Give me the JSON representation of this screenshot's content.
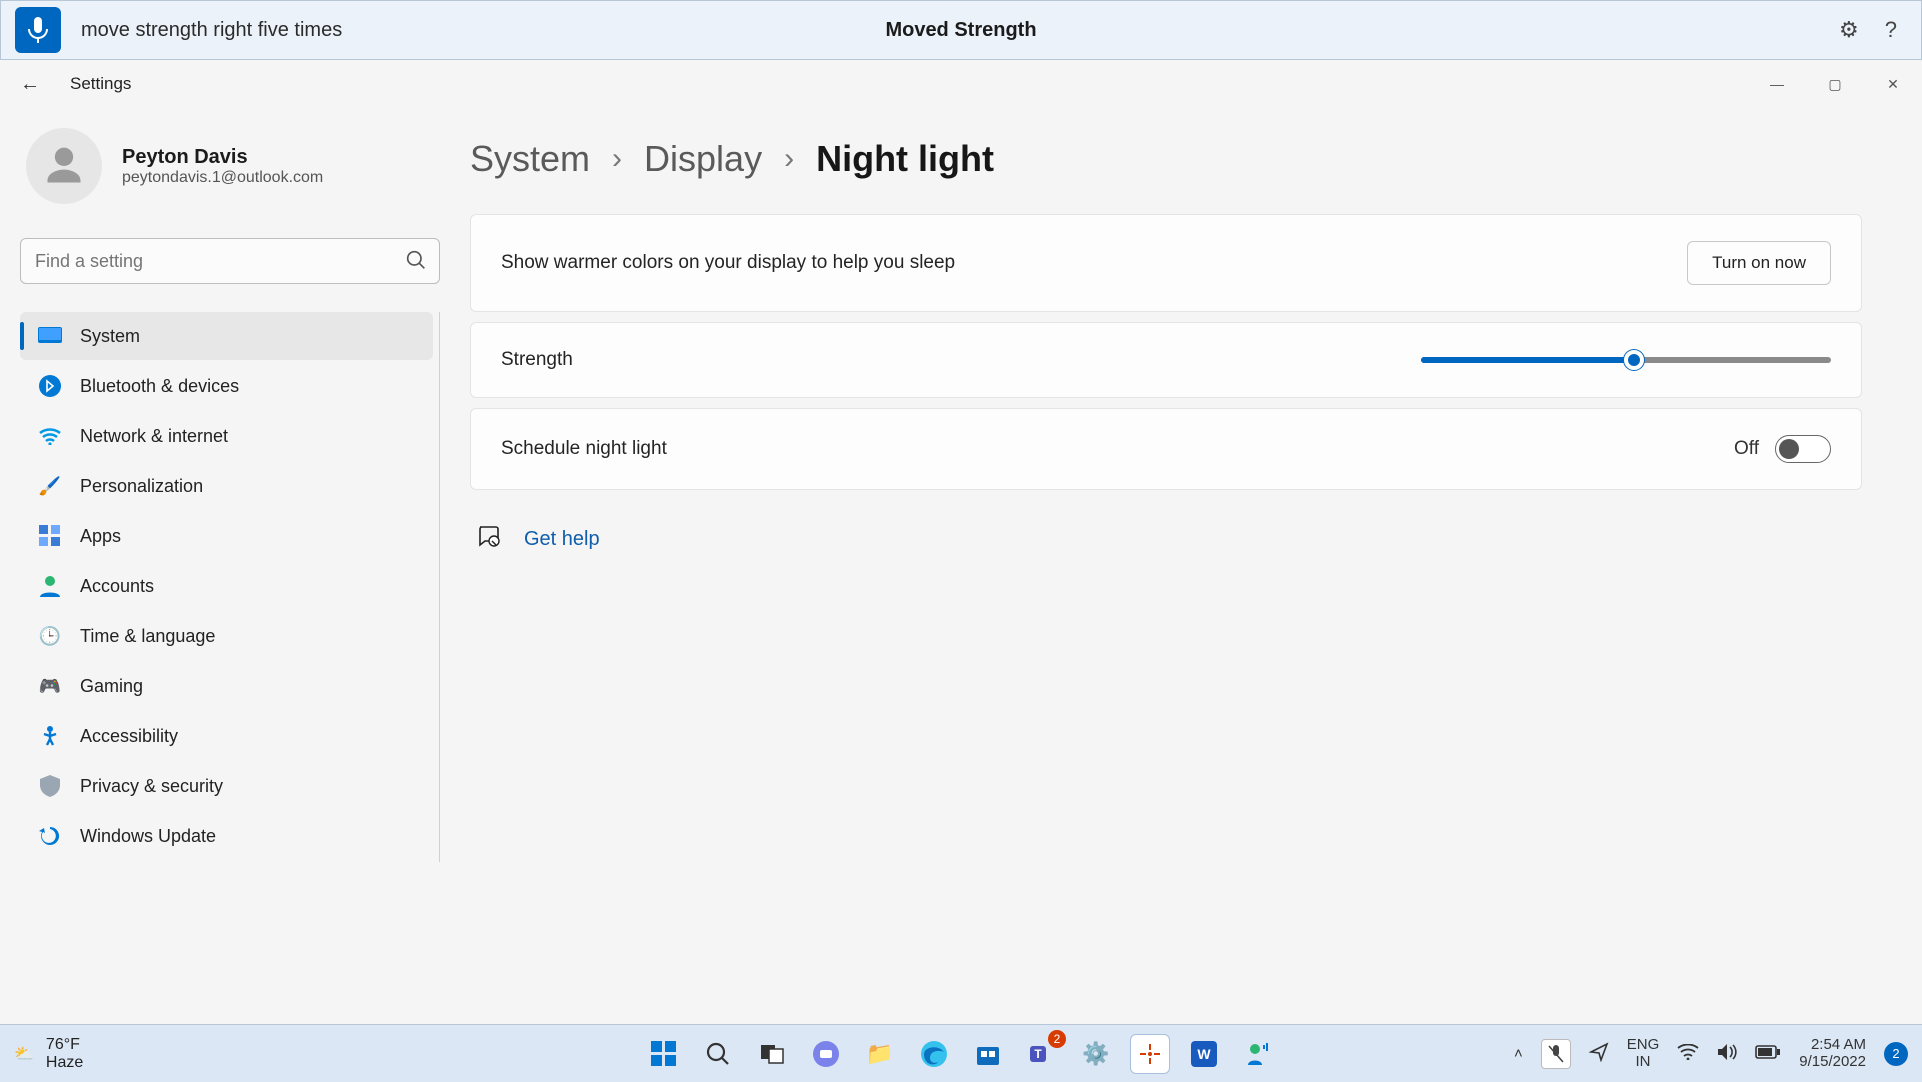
{
  "voicebar": {
    "command": "move strength right five times",
    "title": "Moved Strength"
  },
  "window": {
    "appname": "Settings"
  },
  "profile": {
    "name": "Peyton Davis",
    "email": "peytondavis.1@outlook.com"
  },
  "search": {
    "placeholder": "Find a setting"
  },
  "sidebar": {
    "items": [
      {
        "label": "System",
        "icon": "🖥️",
        "active": true
      },
      {
        "label": "Bluetooth & devices",
        "icon": "ᛒ"
      },
      {
        "label": "Network & internet",
        "icon": "📶"
      },
      {
        "label": "Personalization",
        "icon": "🖌️"
      },
      {
        "label": "Apps",
        "icon": "▦"
      },
      {
        "label": "Accounts",
        "icon": "👤"
      },
      {
        "label": "Time & language",
        "icon": "🕒"
      },
      {
        "label": "Gaming",
        "icon": "🎮"
      },
      {
        "label": "Accessibility",
        "icon": "🚶"
      },
      {
        "label": "Privacy & security",
        "icon": "🛡️"
      },
      {
        "label": "Windows Update",
        "icon": "🔄"
      }
    ]
  },
  "breadcrumb": {
    "a": "System",
    "b": "Display",
    "current": "Night light"
  },
  "cards": {
    "description": "Show warmer colors on your display to help you sleep",
    "turn_on": "Turn on now",
    "strength_label": "Strength",
    "strength_value": 52,
    "schedule_label": "Schedule night light",
    "schedule_state": "Off"
  },
  "help": {
    "label": "Get help"
  },
  "taskbar": {
    "temp": "76°F",
    "cond": "Haze",
    "lang1": "ENG",
    "lang2": "IN",
    "time": "2:54 AM",
    "date": "9/15/2022",
    "notif_count": "2",
    "teams_badge": "2"
  }
}
